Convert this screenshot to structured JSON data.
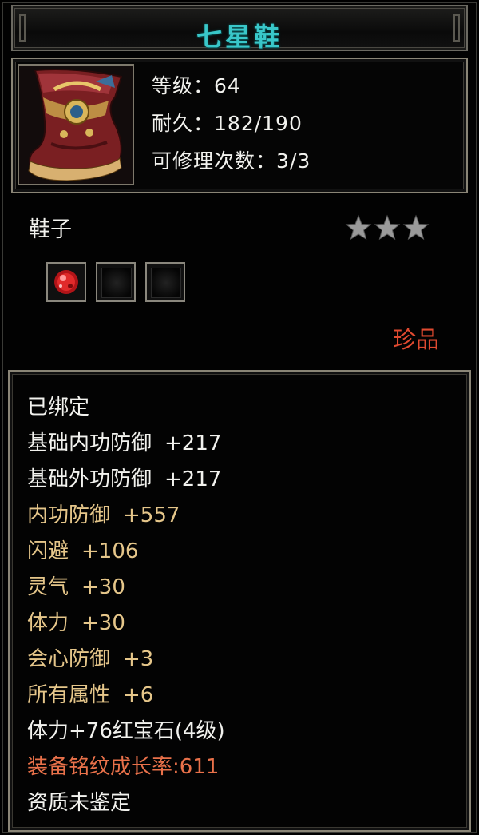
{
  "item": {
    "name": "七星鞋",
    "level_label": "等级：",
    "level_value": "64",
    "durability_label": "耐久：",
    "durability_value": "182/190",
    "repair_label": "可修理次数：",
    "repair_value": "3/3",
    "type": "鞋子",
    "stars": 3,
    "rarity": "珍品",
    "icon": "boot-icon"
  },
  "sockets": [
    {
      "state": "filled",
      "icon": "red-gem-icon"
    },
    {
      "state": "empty",
      "icon": "empty-socket-icon"
    },
    {
      "state": "empty",
      "icon": "empty-socket-icon"
    }
  ],
  "attributes": {
    "bound": "已绑定",
    "base_inner_def_label": "基础内功防御",
    "base_inner_def_value": "+217",
    "base_outer_def_label": "基础外功防御",
    "base_outer_def_value": "+217",
    "inner_def_label": "内功防御",
    "inner_def_value": "+557",
    "dodge_label": "闪避",
    "dodge_value": "+106",
    "spirit_label": "灵气",
    "spirit_value": "+30",
    "stamina_label": "体力",
    "stamina_value": "+30",
    "crit_def_label": "会心防御",
    "crit_def_value": "+3",
    "all_attr_label": "所有属性",
    "all_attr_value": "+6",
    "gem_bonus": "体力+76红宝石(4级)",
    "growth_rate": "装备铭纹成长率:611",
    "quality": "资质未鉴定"
  },
  "colors": {
    "title": "#39c7c9",
    "base_stat": "#f2f2ee",
    "bonus_stat": "#e5c68a",
    "rarity": "#e04a30",
    "growth": "#e9714a"
  }
}
